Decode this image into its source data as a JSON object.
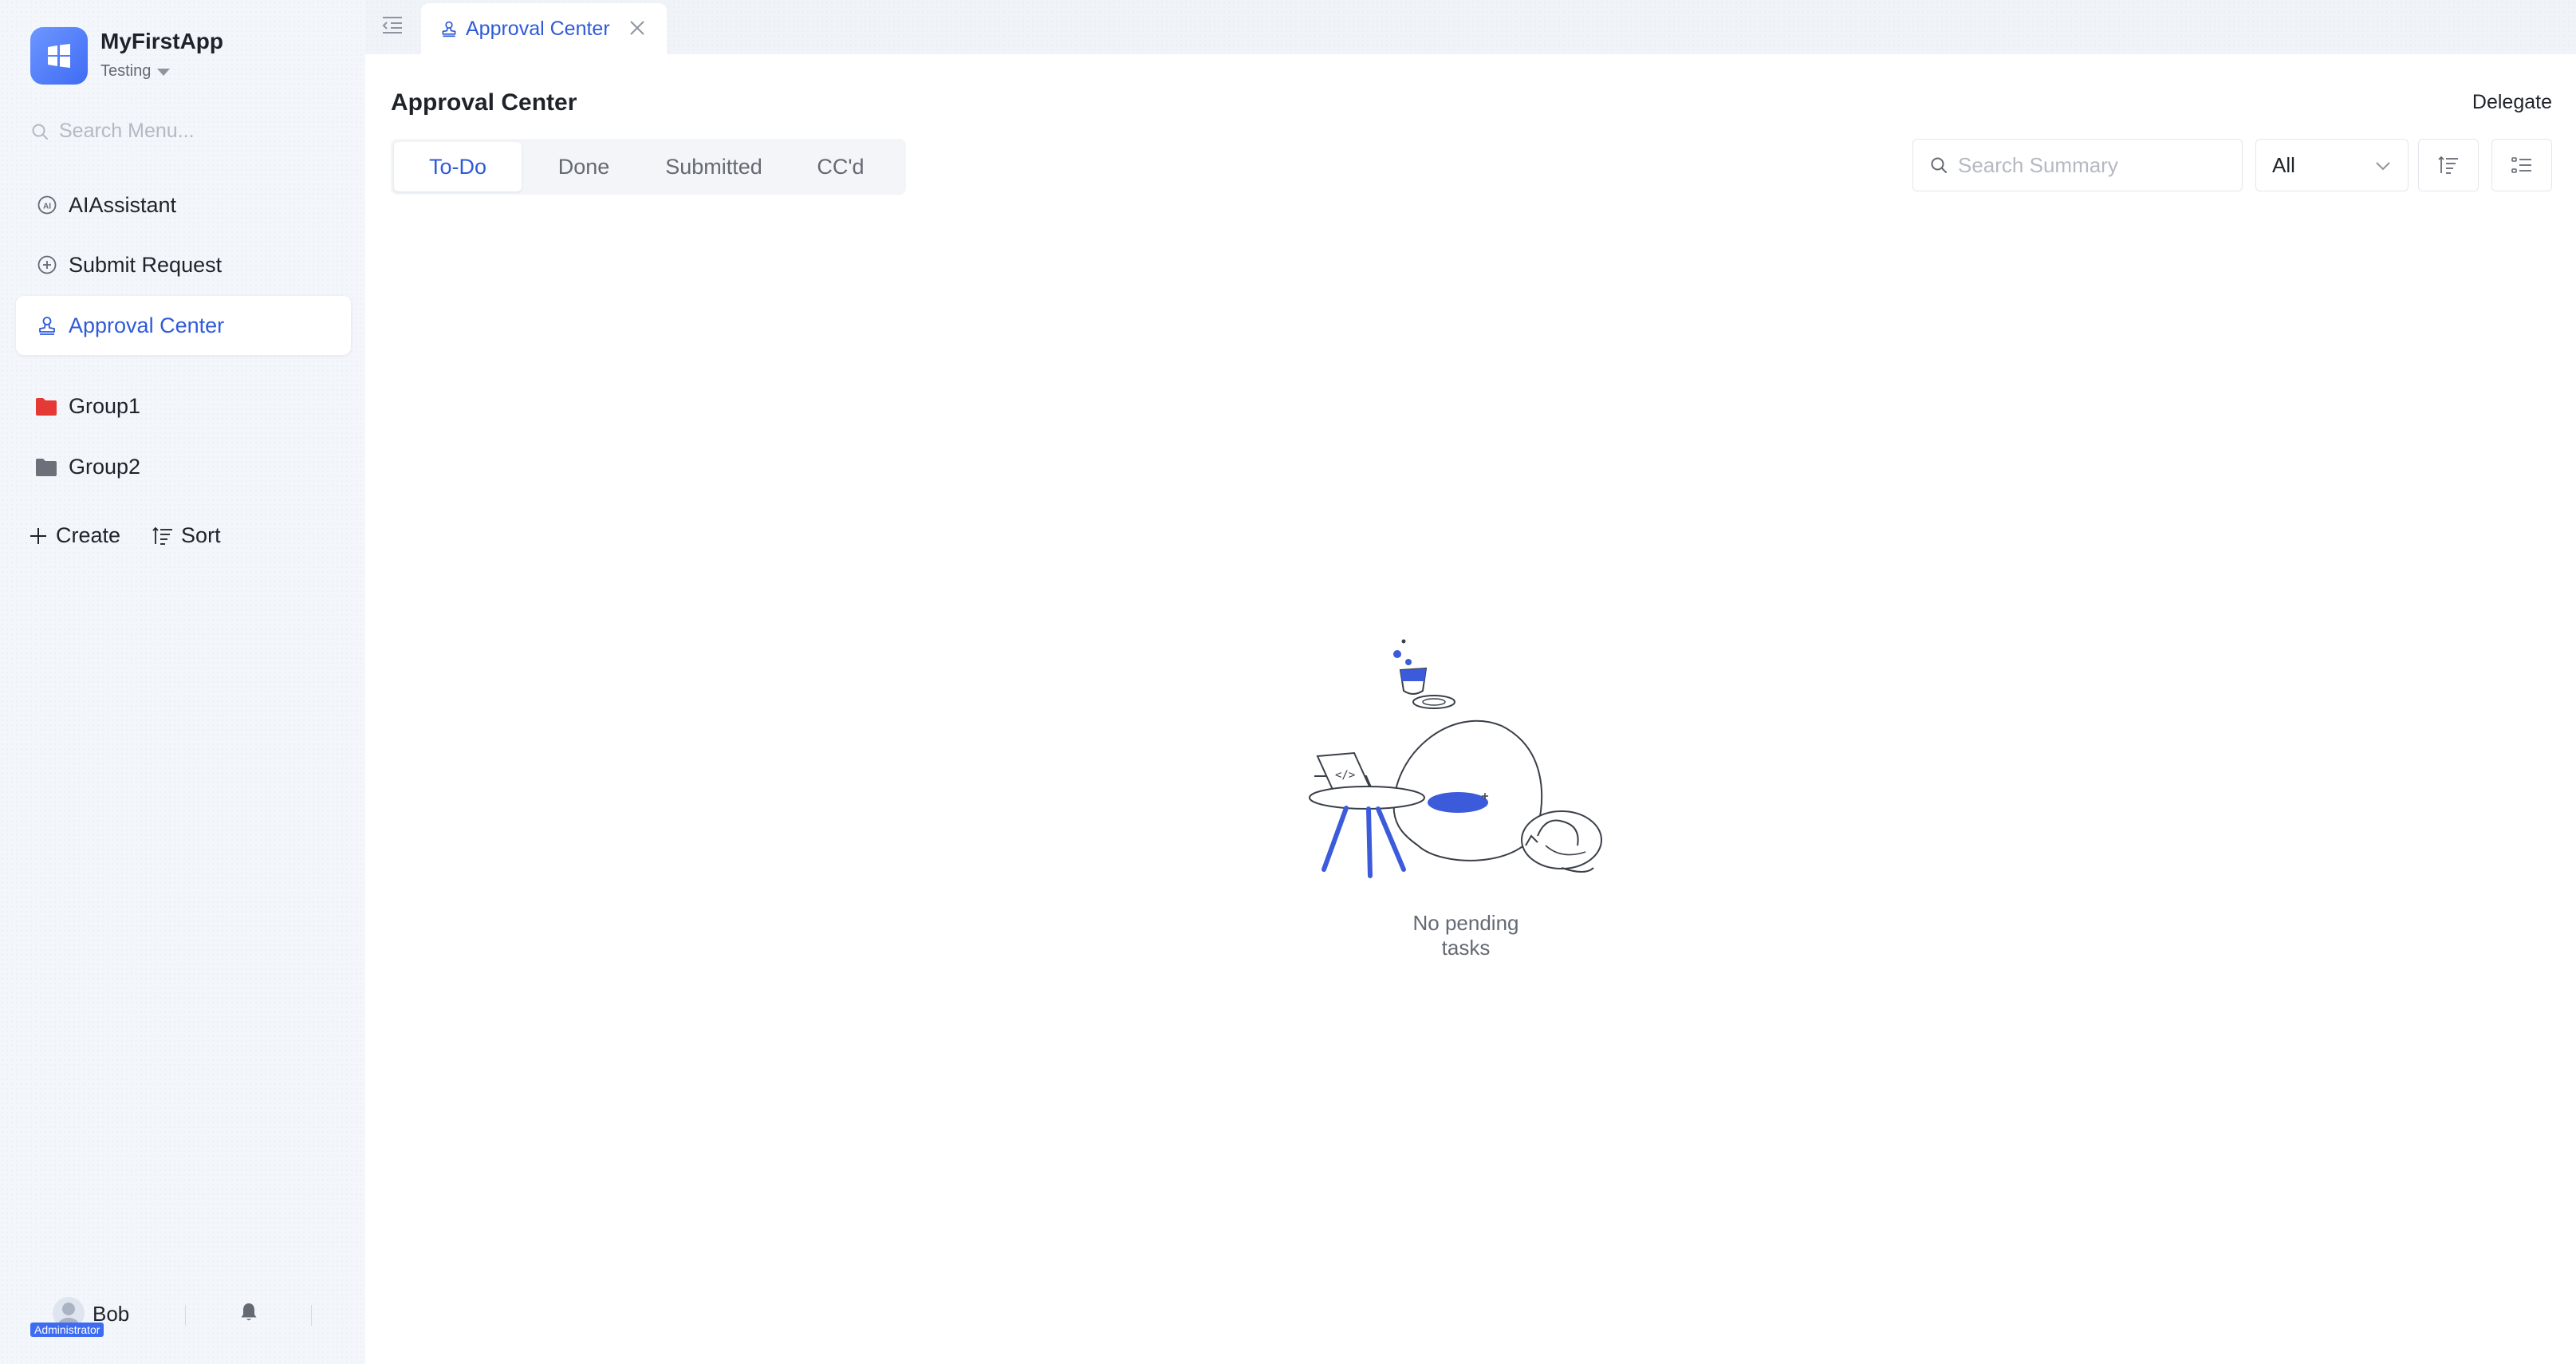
{
  "app": {
    "name": "MyFirstApp",
    "environment": "Testing",
    "logo_icon": "windows-grid-icon",
    "accent_color": "#3f6bf5"
  },
  "sidebar": {
    "search_placeholder": "Search Menu...",
    "nav": [
      {
        "label": "AIAssistant",
        "icon": "ai-icon"
      },
      {
        "label": "Submit Request",
        "icon": "plus-circle-icon"
      },
      {
        "label": "Approval Center",
        "icon": "stamp-icon",
        "active": true
      }
    ],
    "groups": [
      {
        "label": "Group1",
        "icon": "folder-icon",
        "color": "#e53935"
      },
      {
        "label": "Group2",
        "icon": "folder-icon",
        "color": "#6b7079"
      }
    ],
    "actions": {
      "create_label": "Create",
      "sort_label": "Sort"
    }
  },
  "user": {
    "name": "Bob",
    "role": "Administrator"
  },
  "tabs": [
    {
      "label": "Approval Center",
      "icon": "stamp-icon",
      "active": true
    }
  ],
  "main": {
    "title": "Approval Center",
    "delegate_label": "Delegate",
    "segments": [
      {
        "label": "To-Do",
        "active": true
      },
      {
        "label": "Done"
      },
      {
        "label": "Submitted"
      },
      {
        "label": "CC'd"
      }
    ],
    "search_placeholder": "Search Summary",
    "filter_value": "All",
    "empty_text": "No pending tasks"
  }
}
